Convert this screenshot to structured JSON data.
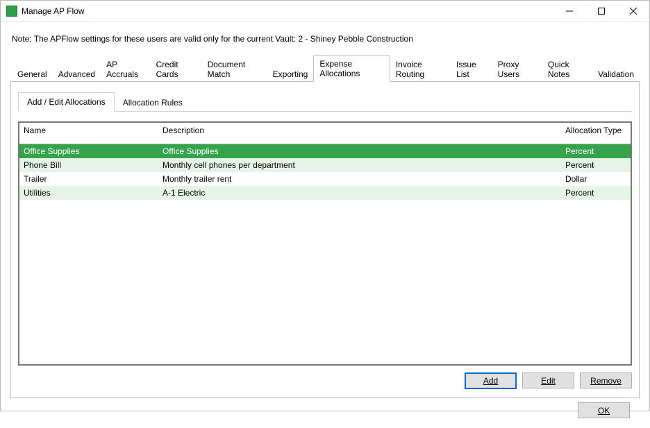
{
  "window": {
    "title": "Manage AP Flow"
  },
  "note": "Note:  The APFlow settings for these users are valid only for the current Vault: 2 - Shiney Pebble Construction",
  "main_tabs": [
    "General",
    "Advanced",
    "AP Accruals",
    "Credit Cards",
    "Document Match",
    "Exporting",
    "Expense Allocations",
    "Invoice Routing",
    "Issue List",
    "Proxy Users",
    "Quick Notes",
    "Validation"
  ],
  "main_tab_active": "Expense Allocations",
  "sub_tabs": [
    "Add / Edit Allocations",
    "Allocation Rules"
  ],
  "sub_tab_active": "Add / Edit Allocations",
  "table": {
    "headers": {
      "name": "Name",
      "description": "Description",
      "type": "Allocation\nType"
    },
    "rows": [
      {
        "name": "Office Supplies",
        "description": "Office Supplies",
        "type": "Percent",
        "selected": true
      },
      {
        "name": "Phone Bill",
        "description": "Monthly cell phones per department",
        "type": "Percent",
        "selected": false
      },
      {
        "name": "Trailer",
        "description": "Monthly trailer rent",
        "type": "Dollar",
        "selected": false
      },
      {
        "name": "Utilities",
        "description": "A-1 Electric",
        "type": "Percent",
        "selected": false
      }
    ]
  },
  "buttons": {
    "add": "Add",
    "edit": "Edit",
    "remove": "Remove",
    "ok": "OK"
  }
}
